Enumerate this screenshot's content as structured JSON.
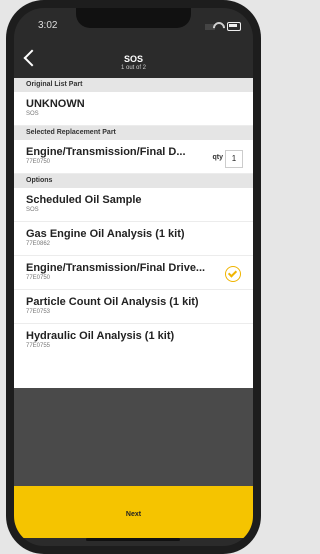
{
  "status_bar": {
    "time": "3:02"
  },
  "nav": {
    "title": "SOS",
    "subtitle": "1 out of 2"
  },
  "original_section": {
    "header": "Original List Part",
    "item": {
      "title": "UNKNOWN",
      "code": "SOS"
    }
  },
  "selected_section": {
    "header": "Selected Replacement  Part",
    "item": {
      "title": "Engine/Transmission/Final D...",
      "code": "77E0750",
      "qty_label": "qty",
      "qty_value": "1"
    }
  },
  "options_section": {
    "header": "Options",
    "items": [
      {
        "title": "Scheduled Oil Sample",
        "code": "SOS",
        "selected": false
      },
      {
        "title": "Gas Engine Oil Analysis (1 kit)",
        "code": "77E0862",
        "selected": false
      },
      {
        "title": "Engine/Transmission/Final Drive...",
        "code": "77E0750",
        "selected": true
      },
      {
        "title": "Particle Count Oil Analysis (1 kit)",
        "code": "77E0753",
        "selected": false
      },
      {
        "title": "Hydraulic Oil Analysis (1 kit)",
        "code": "77E0755",
        "selected": false
      }
    ]
  },
  "footer": {
    "next_label": "Next"
  },
  "colors": {
    "accent": "#f5c400",
    "check": "#f0b400"
  }
}
